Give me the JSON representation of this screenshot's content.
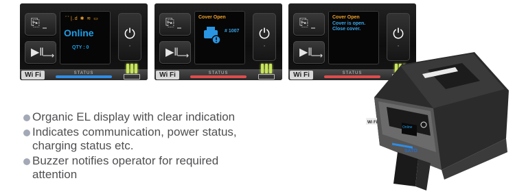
{
  "panels": [
    {
      "status_label": "STATUS",
      "status_color": "#2e8de6",
      "wifi_logo": "Wi Fi",
      "screen": {
        "icons": "ﾞﾞ|.d ✱ ≋ ▭",
        "main": "Online",
        "qty": "QTY : 0"
      }
    },
    {
      "status_label": "STATUS",
      "status_color": "#e04c4c",
      "wifi_logo": "Wi Fi",
      "screen": {
        "title": "Cover Open",
        "number": "# 1007"
      }
    },
    {
      "status_label": "STATUS",
      "status_color": "#e04c4c",
      "wifi_logo": "Wi Fi",
      "screen": {
        "title": "Cover Open",
        "message_line1": "Cover is open.",
        "message_line2": "Close cover."
      }
    }
  ],
  "colors": {
    "bullet": "#a3a9b6",
    "text": "#4f4f52",
    "accent_blue": "#1e9ee8",
    "accent_orange": "#f2a12a"
  },
  "features": [
    [
      "Organic EL display with clear indication"
    ],
    [
      "Indicates communication, power status,",
      "charging status etc."
    ],
    [
      "Buzzer notifies operator for required",
      "attention"
    ]
  ],
  "printer": {
    "brand": "SATO",
    "screen_text": "Online",
    "wifi_logo": "Wi Fi"
  }
}
